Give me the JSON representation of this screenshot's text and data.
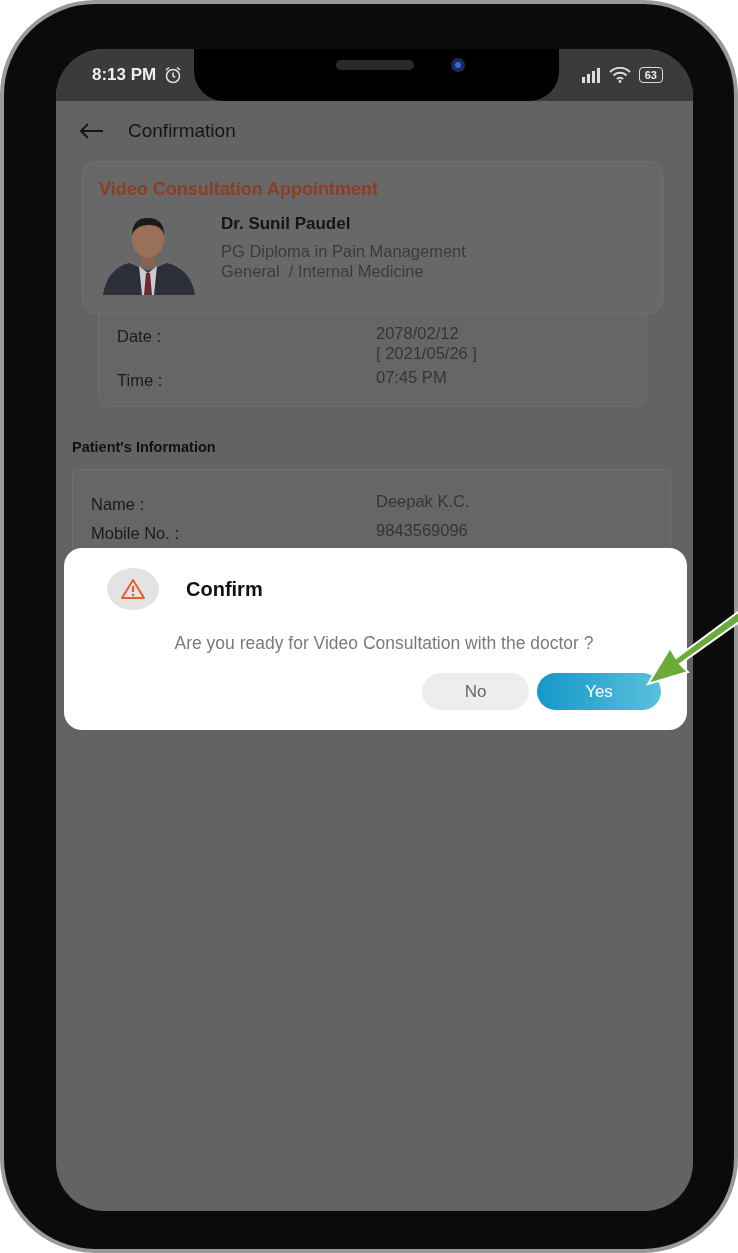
{
  "status_bar": {
    "time": "8:13 PM",
    "battery": "63"
  },
  "header": {
    "title": "Confirmation"
  },
  "appointment": {
    "title": "Video Consultation Appointment",
    "doctor": {
      "name": "Dr. Sunil Paudel",
      "qualification": "PG Diploma in Pain Management",
      "department": "General  / Internal Medicine"
    },
    "details": [
      {
        "label": "Date :",
        "value_lines": [
          "2078/02/12",
          "[ 2021/05/26 ]"
        ]
      },
      {
        "label": "Time :",
        "value_lines": [
          "07:45 PM"
        ]
      }
    ]
  },
  "patient": {
    "title": "Patient's Information",
    "fields": [
      {
        "label": "Name :",
        "value": "Deepak K.C."
      },
      {
        "label": "Mobile No. :",
        "value": "9843569096"
      }
    ]
  },
  "dialog": {
    "title": "Confirm",
    "message": "Are you ready for Video Consultation with the doctor ?",
    "buttons": [
      {
        "label": "No",
        "kind": "secondary"
      },
      {
        "label": "Yes",
        "kind": "primary"
      }
    ]
  }
}
